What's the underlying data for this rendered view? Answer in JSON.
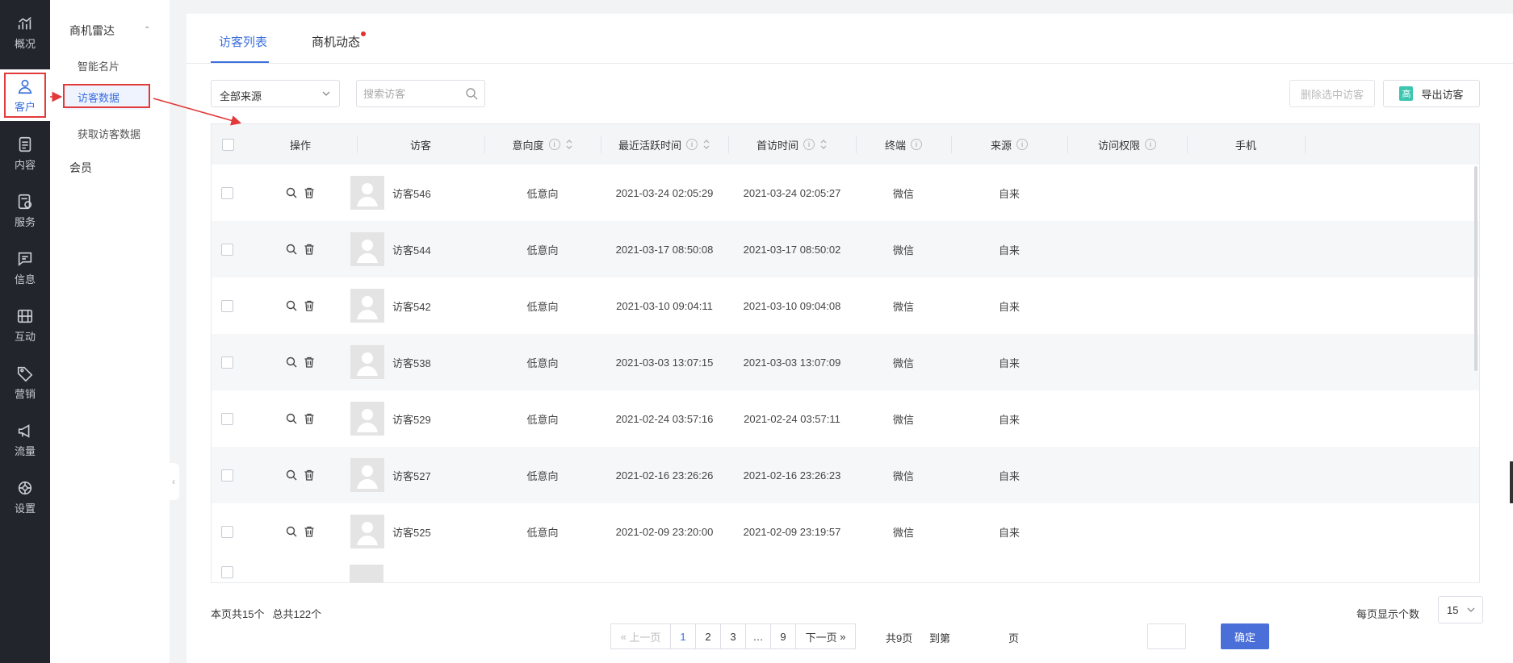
{
  "rail": {
    "items": [
      {
        "label": "概况",
        "icon": "chart-trend-icon"
      },
      {
        "label": "客户",
        "icon": "user-icon",
        "active": true
      },
      {
        "label": "内容",
        "icon": "document-icon"
      },
      {
        "label": "服务",
        "icon": "service-icon"
      },
      {
        "label": "信息",
        "icon": "message-icon"
      },
      {
        "label": "互动",
        "icon": "interaction-icon"
      },
      {
        "label": "营销",
        "icon": "tag-icon"
      },
      {
        "label": "流量",
        "icon": "megaphone-icon"
      },
      {
        "label": "设置",
        "icon": "settings-icon"
      }
    ]
  },
  "submenu": {
    "group": "商机雷达",
    "items": [
      "智能名片",
      "访客数据",
      "获取访客数据"
    ],
    "active": "访客数据",
    "other": "会员"
  },
  "tabs": [
    "访客列表",
    "商机动态"
  ],
  "filters": {
    "source": "全部来源",
    "search_placeholder": "搜索访客"
  },
  "actions": {
    "delete": "删除选中访客",
    "export_tag": "高",
    "export": "导出访客"
  },
  "table": {
    "headers": [
      "操作",
      "访客",
      "意向度",
      "最近活跃时间",
      "首访时间",
      "终端",
      "来源",
      "访问权限",
      "手机"
    ],
    "rows": [
      {
        "name": "访客546",
        "intent": "低意向",
        "last_active": "2021-03-24 02:05:29",
        "first_visit": "2021-03-24 02:05:27",
        "terminal": "微信",
        "source": "自来"
      },
      {
        "name": "访客544",
        "intent": "低意向",
        "last_active": "2021-03-17 08:50:08",
        "first_visit": "2021-03-17 08:50:02",
        "terminal": "微信",
        "source": "自来"
      },
      {
        "name": "访客542",
        "intent": "低意向",
        "last_active": "2021-03-10 09:04:11",
        "first_visit": "2021-03-10 09:04:08",
        "terminal": "微信",
        "source": "自来"
      },
      {
        "name": "访客538",
        "intent": "低意向",
        "last_active": "2021-03-03 13:07:15",
        "first_visit": "2021-03-03 13:07:09",
        "terminal": "微信",
        "source": "自来"
      },
      {
        "name": "访客529",
        "intent": "低意向",
        "last_active": "2021-02-24 03:57:16",
        "first_visit": "2021-02-24 03:57:11",
        "terminal": "微信",
        "source": "自来"
      },
      {
        "name": "访客527",
        "intent": "低意向",
        "last_active": "2021-02-16 23:26:26",
        "first_visit": "2021-02-16 23:26:23",
        "terminal": "微信",
        "source": "自来"
      },
      {
        "name": "访客525",
        "intent": "低意向",
        "last_active": "2021-02-09 23:20:00",
        "first_visit": "2021-02-09 23:19:57",
        "terminal": "微信",
        "source": "自来"
      }
    ]
  },
  "footer": {
    "page_count": "本页共15个",
    "total": "总共122个",
    "page_size_label": "每页显示个数",
    "page_size": "15"
  },
  "pager": {
    "prev": "上一页",
    "pages": [
      "1",
      "2",
      "3",
      "…",
      "9"
    ],
    "current": "1",
    "next": "下一页",
    "total_pages": "共9页",
    "goto": "到第",
    "unit": "页",
    "confirm": "确定"
  },
  "colors": {
    "accent": "#3b6fdc",
    "annotation": "#e23a3a",
    "rail_bg": "#22252c"
  }
}
